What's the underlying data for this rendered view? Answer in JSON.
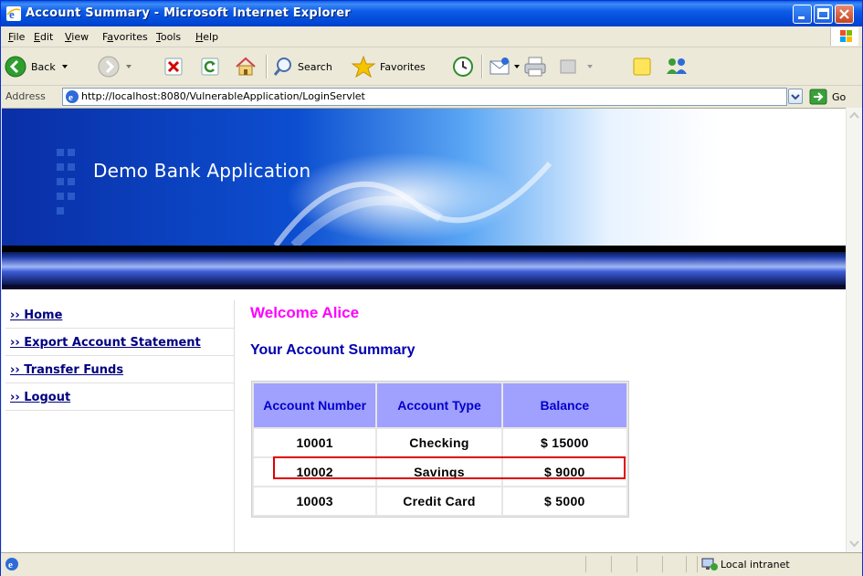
{
  "window": {
    "title": "Account Summary - Microsoft Internet Explorer"
  },
  "menu": [
    {
      "label": "File",
      "key": "F",
      "rest": "ile"
    },
    {
      "label": "Edit",
      "key": "E",
      "rest": "dit"
    },
    {
      "label": "View",
      "key": "V",
      "rest": "iew"
    },
    {
      "label": "Favorites",
      "key": "a",
      "pre": "F",
      "rest": "vorites"
    },
    {
      "label": "Tools",
      "key": "T",
      "rest": "ools"
    },
    {
      "label": "Help",
      "key": "H",
      "rest": "elp"
    }
  ],
  "toolbar": {
    "back_label": "Back",
    "search_label": "Search",
    "favorites_label": "Favorites"
  },
  "address": {
    "label": "Address",
    "url": "http://localhost:8080/VulnerableApplication/LoginServlet",
    "go_label": "Go"
  },
  "page": {
    "banner_title": "Demo Bank Application",
    "nav": [
      {
        "label": "Home"
      },
      {
        "label": "Export Account Statement"
      },
      {
        "label": "Transfer Funds"
      },
      {
        "label": "Logout"
      }
    ],
    "welcome": "Welcome Alice",
    "summary_heading": "Your Account Summary",
    "table": {
      "headers": [
        "Account Number",
        "Account Type",
        "Balance"
      ],
      "rows": [
        [
          "10001",
          "Checking",
          "$ 15000"
        ],
        [
          "10002",
          "Savings",
          "$ 9000"
        ],
        [
          "10003",
          "Credit Card",
          "$ 5000"
        ]
      ]
    }
  },
  "status": {
    "zone": "Local intranet"
  },
  "colors": {
    "welcome": "#ff00ff",
    "heading": "#0000b0",
    "table_header_bg": "#a0a0ff",
    "highlight": "#e00000"
  }
}
